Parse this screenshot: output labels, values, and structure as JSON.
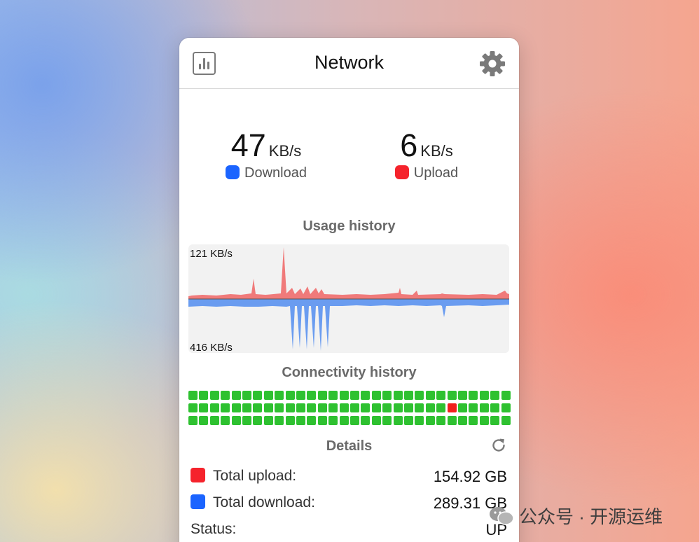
{
  "window": {
    "title": "Network",
    "header_left_icon": "bar-chart-icon",
    "header_right_icon": "gear-icon"
  },
  "speeds": {
    "download": {
      "value": "47",
      "unit": "KB/s",
      "label": "Download",
      "color": "#1b64ff"
    },
    "upload": {
      "value": "6",
      "unit": "KB/s",
      "label": "Upload",
      "color": "#f5232c"
    }
  },
  "usage_history": {
    "title": "Usage history",
    "top_label": "121 KB/s",
    "bottom_label": "416 KB/s",
    "upload_color": "#f07a7a",
    "download_color": "#6a9cf0"
  },
  "connectivity_history": {
    "title": "Connectivity history",
    "rows": 3,
    "cols": 30,
    "statuses": [
      "up",
      "up",
      "up",
      "up",
      "up",
      "up",
      "up",
      "up",
      "up",
      "up",
      "up",
      "up",
      "up",
      "up",
      "up",
      "up",
      "up",
      "up",
      "up",
      "up",
      "up",
      "up",
      "up",
      "up",
      "up",
      "up",
      "up",
      "up",
      "up",
      "up",
      "up",
      "up",
      "up",
      "up",
      "up",
      "up",
      "up",
      "up",
      "up",
      "up",
      "up",
      "up",
      "up",
      "up",
      "up",
      "up",
      "up",
      "up",
      "up",
      "up",
      "up",
      "up",
      "up",
      "up",
      "down",
      "up",
      "up",
      "up",
      "up",
      "up",
      "up",
      "up",
      "up",
      "up",
      "up",
      "up",
      "up",
      "up",
      "up",
      "up",
      "up",
      "up",
      "up",
      "up",
      "up",
      "up",
      "up",
      "up",
      "up",
      "up",
      "up",
      "up",
      "up",
      "up",
      "up",
      "up",
      "up",
      "up",
      "up",
      "up"
    ],
    "up_color": "#2ec130",
    "down_color": "#f1201d"
  },
  "details": {
    "title": "Details",
    "refresh_icon": "refresh-icon",
    "rows": [
      {
        "label": "Total upload:",
        "value": "154.92 GB",
        "color": "#f5232c"
      },
      {
        "label": "Total download:",
        "value": "289.31 GB",
        "color": "#1b64ff"
      },
      {
        "label": "Status:",
        "value": "UP"
      }
    ]
  },
  "watermark": {
    "text": "公众号 · 开源运维",
    "icon": "wechat-icon"
  }
}
